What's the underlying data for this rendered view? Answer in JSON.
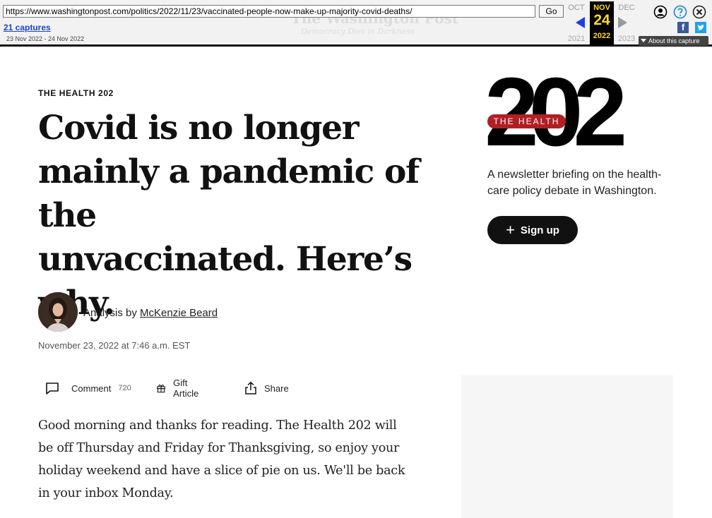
{
  "wayback": {
    "url": "https://www.washingtonpost.com/politics/2022/11/23/vaccinated-people-now-make-up-majority-covid-deaths/",
    "go_label": "Go",
    "captures": "21 captures",
    "range": "23 Nov 2022 - 24 Nov 2022",
    "prev_month": "OCT",
    "current_month": "NOV",
    "current_day": "24",
    "current_year": "2022",
    "next_month": "DEC",
    "prev_year": "2021",
    "next_year": "2023",
    "about_label": "About this capture",
    "ghost_logo": "The Washington Post",
    "ghost_tagline": "Democracy Dies in Darkness",
    "facebook_letter": "f"
  },
  "article": {
    "kicker": "THE HEALTH 202",
    "headline_lines": [
      "Covid is no longer",
      "mainly a pandemic of the",
      "unvaccinated. Here’s",
      "why."
    ],
    "byline_prefix": "Analysis by",
    "author": "McKenzie Beard",
    "date": "November 23, 2022 at 7:46 a.m. EST",
    "actions": {
      "comment_label": "Comment",
      "comment_count": "720",
      "gift_label": "Gift Article",
      "share_label": "Share"
    },
    "body_lines": [
      "Good morning and thanks for reading. The Health 202 will",
      "be off Thursday and Friday for Thanksgiving, so enjoy your",
      "holiday weekend and have a slice of pie on us. We'll be back",
      "in your inbox Monday."
    ]
  },
  "newsletter": {
    "pill_label": "THE HEALTH",
    "number": "202",
    "description_lines": [
      "A newsletter briefing on the health-",
      "care policy debate in Washington."
    ],
    "signup_label": "Sign up",
    "brand_color": "#b11f24"
  }
}
